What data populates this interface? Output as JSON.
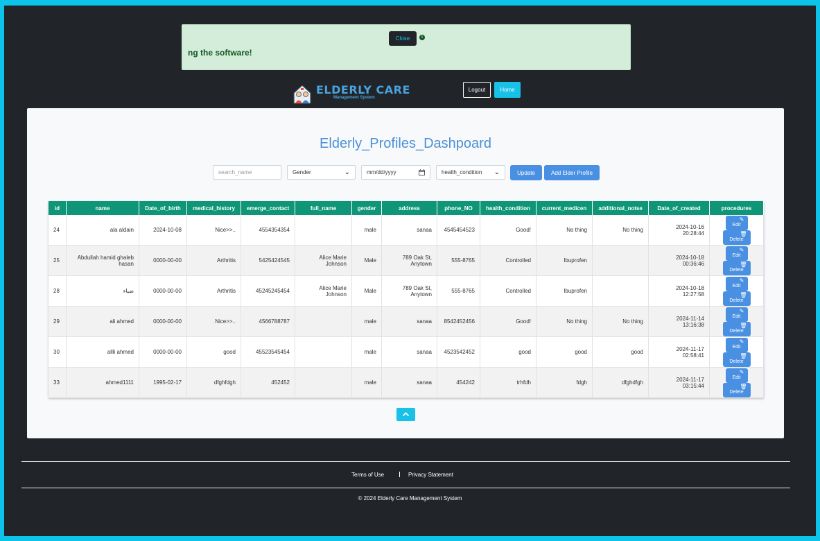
{
  "alert": {
    "message": "ng the software!",
    "close_label": "Close",
    "info_icon": "i"
  },
  "brand": {
    "title": "ELDERLY CARE",
    "subtitle": "Management System",
    "logo_icon": "elderly-couple-house-icon"
  },
  "nav": {
    "logout_label": "Logout",
    "home_label": "Home"
  },
  "dashboard": {
    "title": "Elderly_Profiles_Dashpoard",
    "search_placeholder": "search_name",
    "gender_select": "Gender",
    "date_placeholder": "mm/dd/yyyy",
    "health_select": "health_condition",
    "update_label": "Update",
    "add_label": "Add Elder Profile"
  },
  "table": {
    "columns": [
      "id",
      "name",
      "Date_of_birth",
      "medical_history",
      "emerge_contact",
      "full_name",
      "gender",
      "address",
      "phone_NO",
      "health_condition",
      "current_medicen",
      "additional_notse",
      "Date_of_created",
      "procedures"
    ],
    "rows": [
      {
        "id": "24",
        "name": "ala aldain",
        "dob": "2024-10-08",
        "medical": "Nice>>..",
        "contact": "4554354354",
        "full_name": "",
        "gender": "male",
        "address": "sanaa",
        "phone": "4545454523",
        "health": "Good!",
        "medicine": "No thing",
        "notes": "No thing",
        "created_date": "2024-10-16",
        "created_time": "20:28:44"
      },
      {
        "id": "25",
        "name": "Abdullah hamid ghaleb hasan",
        "dob": "0000-00-00",
        "medical": "Arthritis",
        "contact": "5425424545",
        "full_name": "Alice Marie Johnson",
        "gender": "Male",
        "address": "789 Oak St, Anytown",
        "phone": "555-8765",
        "health": "Controlled",
        "medicine": "Ibuprofen",
        "notes": "",
        "created_date": "2024-10-18",
        "created_time": "00:36:46"
      },
      {
        "id": "28",
        "name": "ضياء",
        "dob": "0000-00-00",
        "medical": "Arthritis",
        "contact": "45245245454",
        "full_name": "Alice Marie Johnson",
        "gender": "Male",
        "address": "789 Oak St, Anytown",
        "phone": "555-8765",
        "health": "Controlled",
        "medicine": "Ibuprofen",
        "notes": "",
        "created_date": "2024-10-18",
        "created_time": "12:27:58"
      },
      {
        "id": "29",
        "name": "ali ahmed",
        "dob": "0000-00-00",
        "medical": "Nice>>..",
        "contact": "4566788787",
        "full_name": "",
        "gender": "male",
        "address": "sanaa",
        "phone": "8542452456",
        "health": "Good!",
        "medicine": "No thing",
        "notes": "No thing",
        "created_date": "2024-11-14",
        "created_time": "13:16:38"
      },
      {
        "id": "30",
        "name": "allli ahmed",
        "dob": "0000-00-00",
        "medical": "good",
        "contact": "45523545454",
        "full_name": "",
        "gender": "male",
        "address": "sanaa",
        "phone": "4523542452",
        "health": "good",
        "medicine": "good",
        "notes": "good",
        "created_date": "2024-11-17",
        "created_time": "02:58:41"
      },
      {
        "id": "33",
        "name": "ahmed1111",
        "dob": "1995-02-17",
        "medical": "dfghfdgh",
        "contact": "452452",
        "full_name": "",
        "gender": "male",
        "address": "sanaa",
        "phone": "454242",
        "health": "trhfdh",
        "medicine": "fdgh",
        "notes": "dfghdfgh",
        "created_date": "2024-11-17",
        "created_time": "03:15:44"
      }
    ],
    "edit_label": "Edit",
    "delete_label": "Delete"
  },
  "footer": {
    "terms_label": "Terms of Use",
    "privacy_label": "Privacy Statement",
    "copyright": "© 2024 Elderly Care Management System"
  },
  "colors": {
    "accent": "#17c1e8",
    "primary": "#4a90e2",
    "table_header": "#0f9678",
    "alert_bg": "#d4edda",
    "dark_bg": "#212529"
  }
}
